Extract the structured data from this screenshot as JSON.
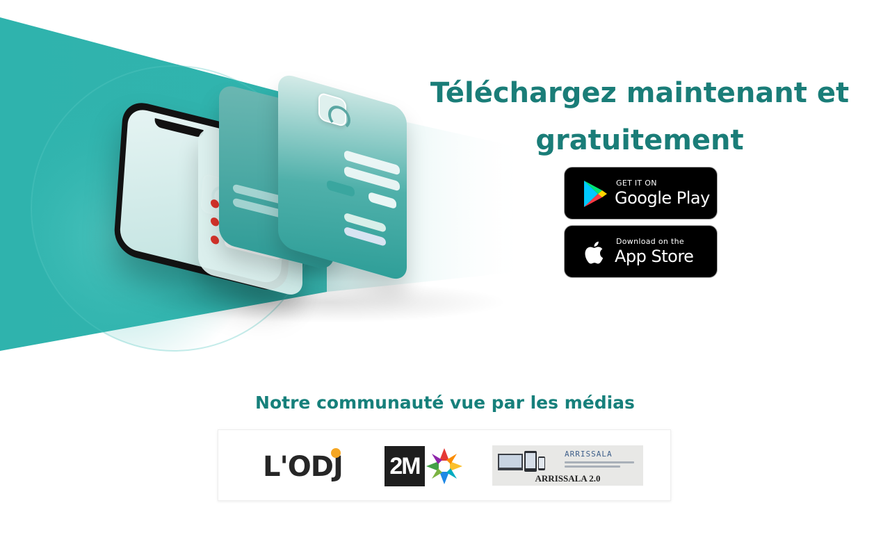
{
  "download": {
    "headline_line1": "Téléchargez maintenant et",
    "headline_line2": "gratuitement",
    "google_play": {
      "small": "GET IT ON",
      "big": "Google Play",
      "icon": "google-play-icon"
    },
    "app_store": {
      "small": "Download on the",
      "big": "App Store",
      "icon": "apple-icon"
    }
  },
  "media": {
    "title": "Notre communauté vue par les médias",
    "logos": [
      {
        "name": "L'ODJ",
        "text": "L'ODJ"
      },
      {
        "name": "2M",
        "text": "2M"
      },
      {
        "name": "ARRISSALA",
        "header": "ARRISSALA",
        "footer": "ARRISSALA 2.0"
      }
    ]
  },
  "colors": {
    "brand_teal": "#1a7d78",
    "hero_teal": "#2fb3ad",
    "store_black": "#000000",
    "lodj_accent": "#f5a623"
  }
}
